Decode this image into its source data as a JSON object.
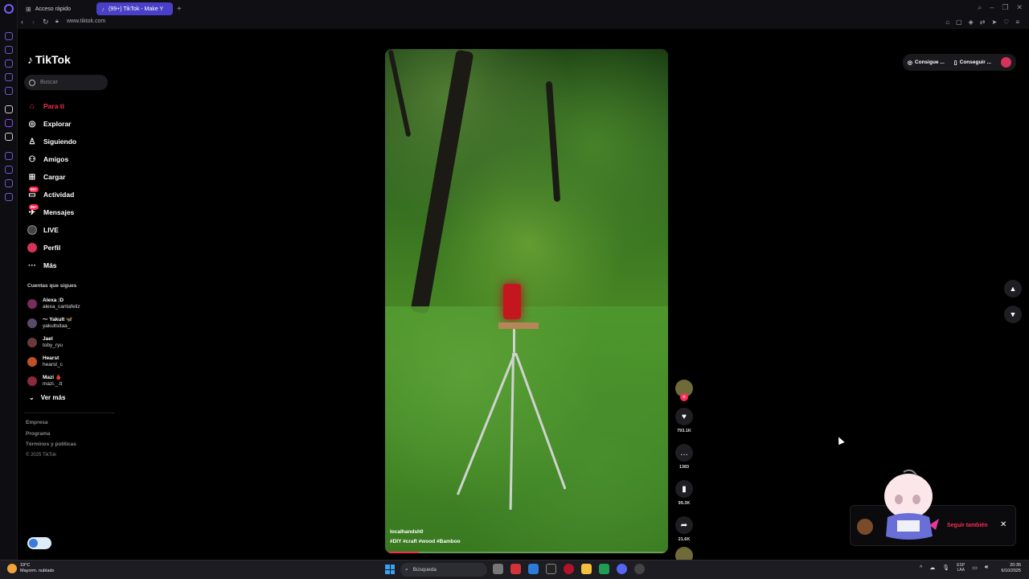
{
  "browser": {
    "tabs": [
      {
        "label": "Acceso rápido",
        "active": false
      },
      {
        "label": "(99+) TikTok - Make Y",
        "active": true
      }
    ],
    "url": "www.tiktok.com"
  },
  "sidebar": {
    "logo_text": "TikTok",
    "search_placeholder": "Buscar",
    "nav": [
      {
        "label": "Para ti",
        "icon": "home-icon",
        "active": true
      },
      {
        "label": "Explorar",
        "icon": "compass-icon"
      },
      {
        "label": "Siguiendo",
        "icon": "following-icon"
      },
      {
        "label": "Amigos",
        "icon": "friends-icon"
      },
      {
        "label": "Cargar",
        "icon": "upload-icon"
      },
      {
        "label": "Actividad",
        "icon": "activity-icon",
        "badge": "99+"
      },
      {
        "label": "Mensajes",
        "icon": "messages-icon",
        "badge": "99+"
      },
      {
        "label": "LIVE",
        "icon": "live-icon"
      },
      {
        "label": "Perfil",
        "icon": "profile-icon"
      },
      {
        "label": "Más",
        "icon": "more-icon"
      }
    ],
    "following_title": "Cuentas que sigues",
    "accounts": [
      {
        "name": "Alexa :D",
        "handle": "alexa_caritafeliz",
        "color": "#7a2d5a"
      },
      {
        "name": "～ Yakult 🦋",
        "handle": "yakultsitaa_",
        "color": "#5a4a6a"
      },
      {
        "name": "Jael",
        "handle": "toby_ryu",
        "color": "#6a3a3a"
      },
      {
        "name": "Hearst",
        "handle": "hearst_c",
        "color": "#c0502a"
      },
      {
        "name": "Mazi 🩸",
        "handle": "mazi._.tt",
        "color": "#8a2a3a"
      }
    ],
    "see_more": "Ver más",
    "footer": [
      "Empresa",
      "Programa",
      "Términos y políticas"
    ],
    "copyright": "© 2025 TikTok"
  },
  "video": {
    "username": "localhandsh0",
    "hashtags": "#DIY  #craft  #wood  #Bamboo",
    "progress": 0.12
  },
  "actions": {
    "likes": "793.1K",
    "comments": "1383",
    "saves": "99.3K",
    "shares": "21.6K"
  },
  "topbar": {
    "btn1": "Consigue ...",
    "btn2": "Conseguir ..."
  },
  "toast": {
    "follow_label": "Seguir también"
  },
  "taskbar": {
    "weather_temp": "19°C",
    "weather_desc": "Mayorm. nublado",
    "search_label": "Búsqueda",
    "lang_1": "ESP",
    "lang_2": "LAA",
    "time": "20:35",
    "date": "6/10/2025"
  },
  "colors": {
    "accent": "#fe2c55",
    "browser_accent": "#4a3fc7"
  }
}
